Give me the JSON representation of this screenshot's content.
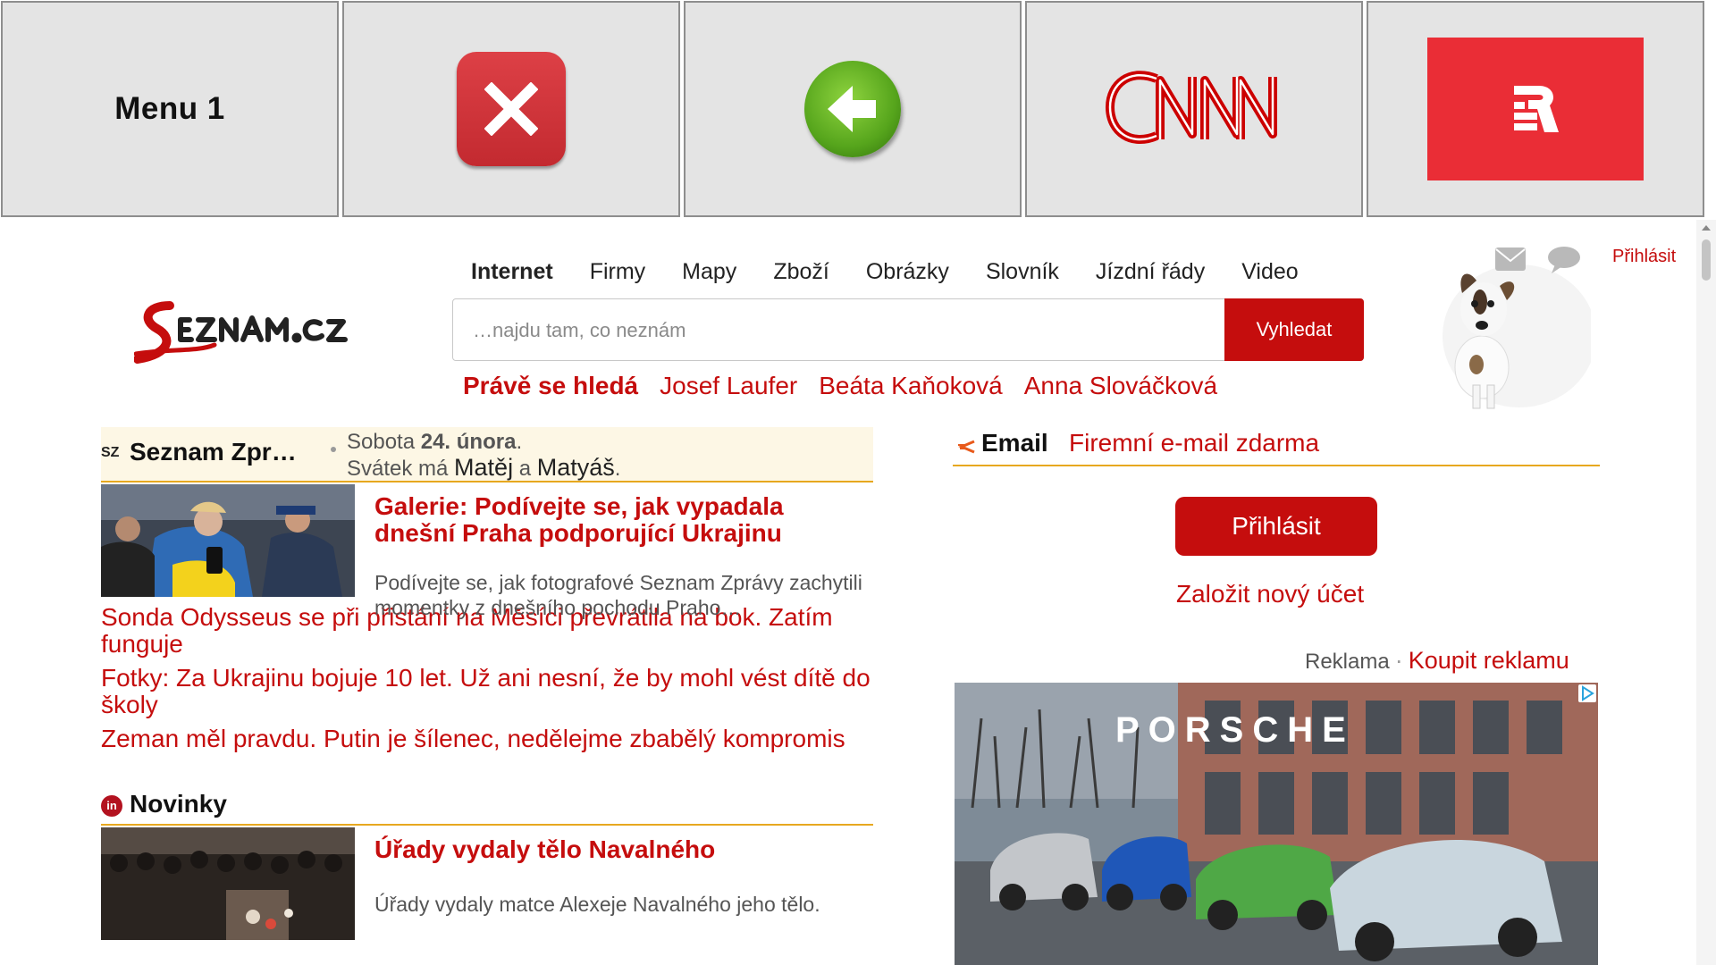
{
  "tiles": {
    "menu_label": "Menu 1"
  },
  "nav": {
    "items": [
      "Internet",
      "Firmy",
      "Mapy",
      "Zboží",
      "Obrázky",
      "Slovník",
      "Jízdní řády",
      "Video"
    ]
  },
  "header": {
    "login_label": "Přihlásit"
  },
  "search": {
    "placeholder": "…najdu tam, co neznám",
    "button_label": "Vyhledat"
  },
  "trending": {
    "label": "Právě se hledá",
    "items": [
      "Josef Laufer",
      "Beáta Kaňoková",
      "Anna Slováčková"
    ]
  },
  "news": {
    "source": "Seznam Zpr…",
    "source_icon": "SZ",
    "date_prefix": "Sobota ",
    "date": "24. února",
    "date_suffix": ".",
    "nameday_prefix": "Svátek má ",
    "name1": "Matěj",
    "nameday_and": " a ",
    "name2": "Matyáš",
    "nameday_suffix": ".",
    "featured_title": "Galerie: Podívejte se, jak vypadala dnešní Praha podporující Ukrajinu",
    "featured_desc": "Podívejte se, jak fotografové Seznam Zprávy zachytili momentky z dnešního pochodu Praho…",
    "headlines": [
      "Sonda Odysseus se při přistání na Měsíci převrátila na bok. Zatím funguje",
      "Fotky: Za Ukrajinu bojuje 10 let. Už ani nesní, že by mohl vést dítě do školy",
      "Zeman měl pravdu. Putin je šílenec, nedělejme zbabělý kompromis"
    ]
  },
  "novinky": {
    "icon_text": "in",
    "name": "Novinky",
    "featured_title": "Úřady vydaly tělo Navalného",
    "featured_desc": "Úřady vydaly matce Alexeje Navalného jeho tělo."
  },
  "email": {
    "title": "Email",
    "link": "Firemní e-mail zdarma",
    "login_button": "Přihlásit",
    "create_account": "Založit nový účet"
  },
  "ad": {
    "label": "Reklama",
    "separator": "·",
    "buy_link": "Koupit reklamu",
    "brand": "PORSCHE"
  },
  "colors": {
    "brand_red": "#c50d0d",
    "tile_gray": "#e4e4e4",
    "accent_orange": "#e7a81f"
  }
}
